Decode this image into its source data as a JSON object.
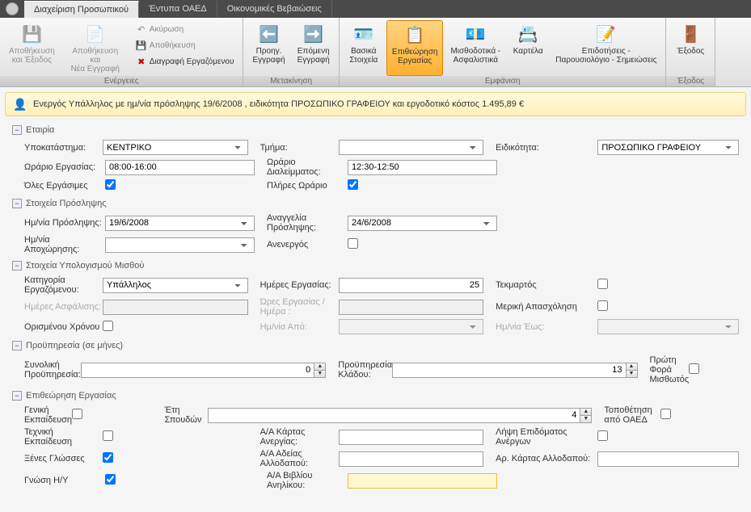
{
  "tabs": {
    "t1": "Διαχείριση Προσωπικού",
    "t2": "Έντυπα ΟΑΕΔ",
    "t3": "Οικονομικές Βεβαιώσεις"
  },
  "ribbon": {
    "group1": {
      "title": "Ενέργειες",
      "btn_save_exit": "Αποθήκευση\nκαι Έξοδος",
      "btn_save_new": "Αποθήκευση και\nΝέα Εγγραφή",
      "btn_undo": "Ακύρωση",
      "btn_save": "Αποθήκευση",
      "btn_delete": "Διαγραφή Εργαζόμενου"
    },
    "group2": {
      "title": "Μετακίνηση",
      "btn_prev": "Προηγ.\nΕγγραφή",
      "btn_next": "Επόμενη\nΕγγραφή"
    },
    "group3": {
      "title": "Εμφάνιση",
      "btn_basic": "Βασικά\nΣτοιχεία",
      "btn_inspect": "Επιθεώρηση\nΕργασίας",
      "btn_payroll": "Μισθοδοτικά -\nΑσφαλιστικά",
      "btn_card": "Καρτέλα",
      "btn_subsidy": "Επιδοτήσεις -\nΠαρουσιολόγιο - Σημειώσεις"
    },
    "group4": {
      "title": "Έξοδος",
      "btn_exit": "Έξοδος"
    }
  },
  "info_bar": "Ενεργός Υπάλληλος με ημ/νία πρόσληψης 19/6/2008 , ειδικότητα ΠΡΟΣΩΠΙΚΟ ΓΡΑΦΕΙΟΥ και εργοδοτικό κόστος 1.495,89 €",
  "sections": {
    "company": "Εταιρία",
    "hiring": "Στοιχεία Πρόσληψης",
    "salary": "Στοιχεία Υπολογισμού Μισθού",
    "experience": "Προϋπηρεσία (σε μήνες)",
    "inspection": "Επιθεώρηση Εργασίας"
  },
  "labels": {
    "branch": "Υποκατάστημα:",
    "workhours": "Ωράριο Εργασίας:",
    "allworkdays": "Όλες Εργάσιμες",
    "department": "Τμήμα:",
    "breakhours": "Ωράριο Διαλείμματος:",
    "fulltime": "Πλήρες Ωράριο",
    "specialty": "Ειδικότητα:",
    "hiredate": "Ημ/νία Πρόσληψης:",
    "leavedate": "Ημ/νία Αποχώρησης:",
    "announcement": "Αναγγελία Πρόσληψης:",
    "inactive": "Ανενεργός",
    "category": "Κατηγορία Εργαζόμενου:",
    "insurance_days": "Ημέρες Ασφάλισης:",
    "fixed_term": "Ορισμένου Χρόνου",
    "workdays": "Ημέρες Εργασίας:",
    "hours_per_day": "Ώρες Εργασίας / Ημέρα :",
    "date_from": "Ημ/νία Από:",
    "tekmartos": "Τεκμαρτός",
    "parttime": "Μερική Απασχόληση",
    "date_to": "Ημ/νία Έως:",
    "total_exp": "Συνολική Προϋπηρεσία:",
    "branch_exp": "Προϋπηρεσία Κλάδου:",
    "first_time": "Πρώτη Φορά Μισθωτός",
    "general_edu": "Γενική Εκπαίδευση",
    "tech_edu": "Τεχνική Εκπαίδευση",
    "languages": "Ξένες Γλώσσες",
    "computer": "Γνώση Η/Υ",
    "study_years": "Έτη Σπουδών",
    "unemp_card": "Α/Α Κάρτας Ανεργίας:",
    "foreign_permit": "Α/Α Αδείας Αλλοδαπού:",
    "minor_book": "Α/Α Βιβλίου Ανηλίκου:",
    "oaed_place": "Τοποθέτηση από ΟΑΕΔ",
    "unemp_benefit": "Λήψη Επιδόματος Ανέργων",
    "foreign_card_no": "Αρ. Κάρτας Αλλοδαπού:"
  },
  "values": {
    "branch": "ΚΕΝΤΡΙΚΟ",
    "workhours": "08:00-16:00",
    "allworkdays": true,
    "department": "",
    "breakhours": "12:30-12:50",
    "fulltime": true,
    "specialty": "ΠΡΟΣΩΠΙΚΟ ΓΡΑΦΕΙΟΥ",
    "hiredate": "19/6/2008",
    "leavedate": "",
    "announcement": "24/6/2008",
    "inactive": false,
    "category": "Υπάλληλος",
    "insurance_days": "",
    "fixed_term": false,
    "workdays": "25",
    "hours_per_day": "",
    "date_from": "",
    "tekmartos": false,
    "parttime": false,
    "date_to": "",
    "total_exp": "0",
    "branch_exp": "13",
    "first_time": false,
    "general_edu": false,
    "tech_edu": false,
    "languages": true,
    "computer": true,
    "study_years": "4",
    "unemp_card": "",
    "foreign_permit": "",
    "minor_book": "",
    "oaed_place": false,
    "unemp_benefit": false,
    "foreign_card_no": ""
  }
}
